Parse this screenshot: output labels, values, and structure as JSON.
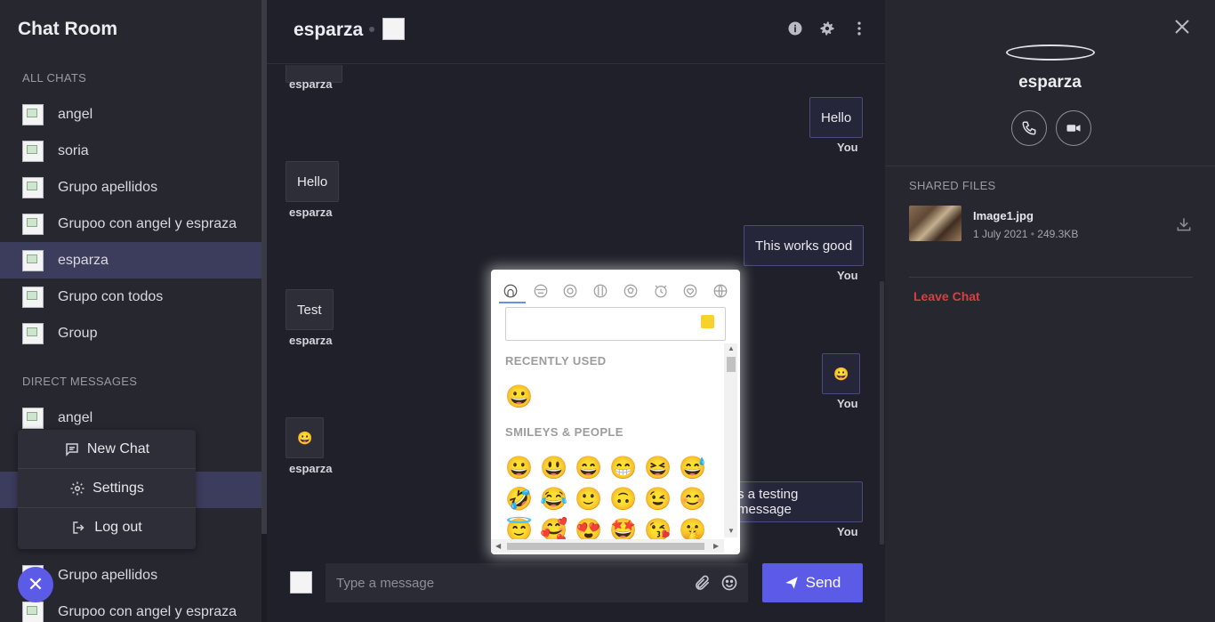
{
  "sidebar": {
    "title": "Chat Room",
    "all_chats_label": "ALL CHATS",
    "all_chats": [
      "angel",
      "soria",
      "Grupo apellidos",
      "Grupoo con angel y espraza",
      "esparza",
      "Grupo con todos",
      "Group"
    ],
    "direct_label": "DIRECT MESSAGES",
    "direct_messages": [
      "angel",
      "Grupo apellidos",
      "Grupoo con angel y espraza"
    ],
    "active_chat": "esparza"
  },
  "menu": {
    "new_chat": "New Chat",
    "settings": "Settings",
    "logout": "Log out",
    "fab": "✕"
  },
  "header": {
    "title": "esparza"
  },
  "messages": [
    {
      "dir": "in",
      "sender": "esparza"
    },
    {
      "dir": "out",
      "text": "Hello",
      "sender": "You"
    },
    {
      "dir": "in",
      "text": "Hello",
      "sender": "esparza"
    },
    {
      "dir": "out",
      "text": "This works good",
      "sender": "You"
    },
    {
      "dir": "in",
      "text": "Test",
      "sender": "esparza"
    },
    {
      "dir": "out",
      "text": "😀",
      "sender": "You"
    },
    {
      "dir": "in",
      "text": "😀",
      "sender": "esparza"
    },
    {
      "dir": "out",
      "text": "s a testing message",
      "sender": "You"
    }
  ],
  "composer": {
    "placeholder": "Type a message",
    "send_label": "Send"
  },
  "emoji_picker": {
    "tabs": [
      "people-icon",
      "nature-icon",
      "food-icon",
      "places-icon",
      "activity-icon",
      "objects-icon",
      "symbols-icon",
      "flags-icon"
    ],
    "recent_label": "RECENTLY USED",
    "recent": [
      "😀"
    ],
    "smileys_label": "SMILEYS & PEOPLE",
    "smileys": [
      "😀",
      "😃",
      "😄",
      "😁",
      "😆",
      "😅",
      "🤣",
      "😂",
      "🙂",
      "🙃",
      "😉",
      "😊",
      "😇",
      "🥰",
      "😍",
      "🤩",
      "😘",
      "🤫"
    ],
    "skin_tone_color": "#f8d22c"
  },
  "details": {
    "name": "esparza",
    "shared_label": "SHARED FILES",
    "file_name": "Image1.jpg",
    "file_date": "1 July 2021",
    "file_size": "249.3KB",
    "leave": "Leave Chat"
  },
  "colors": {
    "accent": "#5b5be8",
    "danger": "#d84040",
    "active_item": "#3c3c5c"
  }
}
